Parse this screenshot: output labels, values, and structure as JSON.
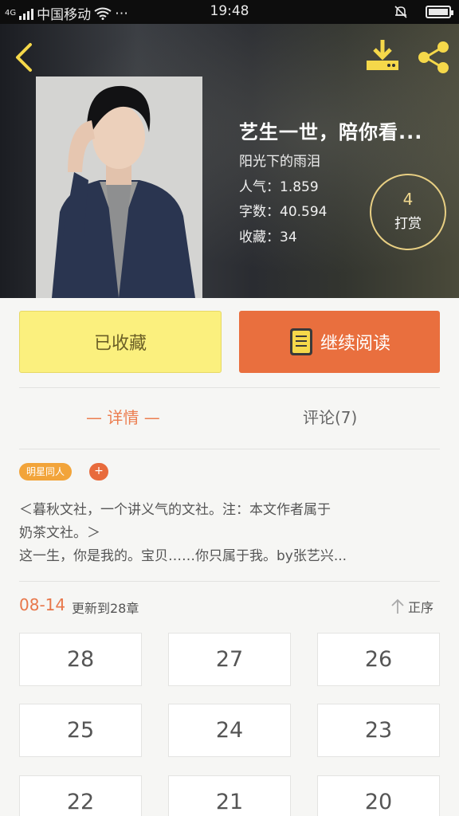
{
  "status_bar": {
    "network": "4G",
    "carrier": "中国移动",
    "more": "⋯",
    "time": "19:48"
  },
  "book": {
    "title": "艺生一世，陪你看...",
    "author": "阳光下的雨泪",
    "popularity": "人气：1.859",
    "word_count": "字数：40.594",
    "favorites": "收藏：34",
    "reward_count": "4",
    "reward_label": "打赏"
  },
  "actions": {
    "favorite_label": "已收藏",
    "continue_label": "继续阅读"
  },
  "tabs": {
    "detail": "— 详情 —",
    "comments": "评论(7)"
  },
  "tags": {
    "category": "明星同人",
    "add": "+"
  },
  "description": [
    "＜暮秋文社，一个讲义气的文社。注：本文作者属于",
    "奶茶文社。＞",
    "这一生，你是我的。宝贝……你只属于我。by张艺兴..."
  ],
  "update": {
    "date": "08-14",
    "text": "更新到28章",
    "sort_label": "正序"
  },
  "chapters": [
    "28",
    "27",
    "26",
    "25",
    "24",
    "23",
    "22",
    "21",
    "20"
  ],
  "colors": {
    "accent_orange": "#e96f3e",
    "favorite_yellow": "#fbf07e",
    "icon_yellow": "#f5d84a"
  }
}
